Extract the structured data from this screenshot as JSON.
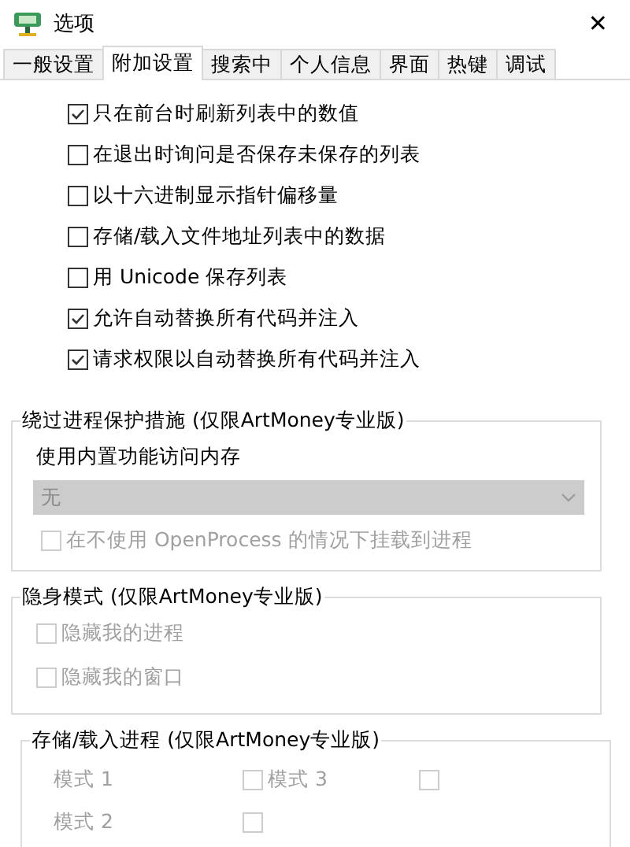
{
  "window": {
    "title": "选项",
    "close": "✕"
  },
  "tabs": [
    {
      "label": "一般设置",
      "selected": false
    },
    {
      "label": "附加设置",
      "selected": true
    },
    {
      "label": "搜索中",
      "selected": false
    },
    {
      "label": "个人信息",
      "selected": false
    },
    {
      "label": "界面",
      "selected": false
    },
    {
      "label": "热键",
      "selected": false
    },
    {
      "label": "调试",
      "selected": false
    }
  ],
  "options": [
    {
      "label": "只在前台时刷新列表中的数值",
      "checked": true
    },
    {
      "label": "在退出时询问是否保存未保存的列表",
      "checked": false
    },
    {
      "label": "以十六进制显示指针偏移量",
      "checked": false
    },
    {
      "label": "存储/载入文件地址列表中的数据",
      "checked": false
    },
    {
      "label": "用 Unicode 保存列表",
      "checked": false
    },
    {
      "label": "允许自动替换所有代码并注入",
      "checked": true
    },
    {
      "label": "请求权限以自动替换所有代码并注入",
      "checked": true
    }
  ],
  "bypass_group": {
    "title": "绕过进程保护措施 (仅限ArtMoney专业版)",
    "label": "使用内置功能访问内存",
    "dropdown": {
      "value": "无",
      "disabled": true
    },
    "checkbox": {
      "label": "在不使用 OpenProcess 的情况下挂载到进程",
      "checked": false,
      "disabled": true
    }
  },
  "stealth_group": {
    "title": "隐身模式 (仅限ArtMoney专业版)",
    "items": [
      {
        "label": "隐藏我的进程",
        "checked": false,
        "disabled": true
      },
      {
        "label": "隐藏我的窗口",
        "checked": false,
        "disabled": true
      }
    ]
  },
  "process_group": {
    "title": "存储/载入进程 (仅限ArtMoney专业版)",
    "rows": [
      [
        {
          "kind": "label",
          "label": "模式 1",
          "disabled": true
        },
        {
          "kind": "checkbox",
          "label": "模式 3",
          "checked": false,
          "disabled": true
        },
        {
          "kind": "checkbox",
          "checked": false,
          "disabled": true
        }
      ],
      [
        {
          "kind": "label",
          "label": "模式 2",
          "disabled": true
        },
        {
          "kind": "checkbox",
          "checked": false,
          "disabled": true
        }
      ]
    ]
  }
}
